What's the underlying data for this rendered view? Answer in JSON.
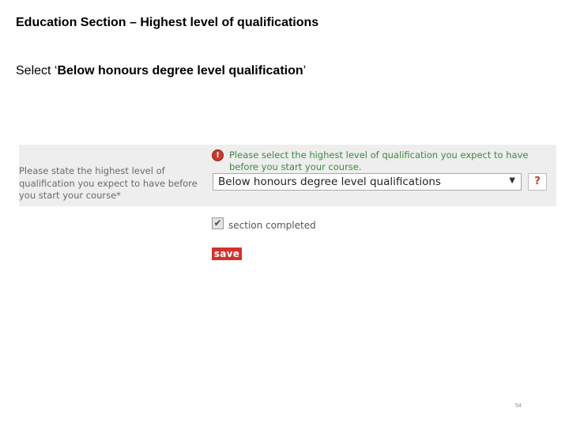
{
  "slide": {
    "title": "Education Section – Highest level of qualifications",
    "instruction_prefix": "Select ‘",
    "instruction_emphasis": "Below honours degree level qualification",
    "instruction_suffix": "’",
    "page_number": "54"
  },
  "form": {
    "question_label": "Please state the highest level of qualification you expect to have before you start your course*",
    "warning_icon": "!",
    "warning_text": "Please select the highest level of qualification you expect to have before you start your course.",
    "select_value": "Below honours degree level qualifications",
    "select_arrow": "▼",
    "help_label": "?",
    "checkbox_checked": true,
    "checkbox_mark": "✔",
    "checkbox_label": "section completed",
    "save_label": "save"
  },
  "colors": {
    "panel_bg": "#eeeeee",
    "warning_text": "#3d8a3d",
    "warning_icon": "#c8392e",
    "save_button": "#d3312a",
    "help_mark": "#c8392e"
  }
}
